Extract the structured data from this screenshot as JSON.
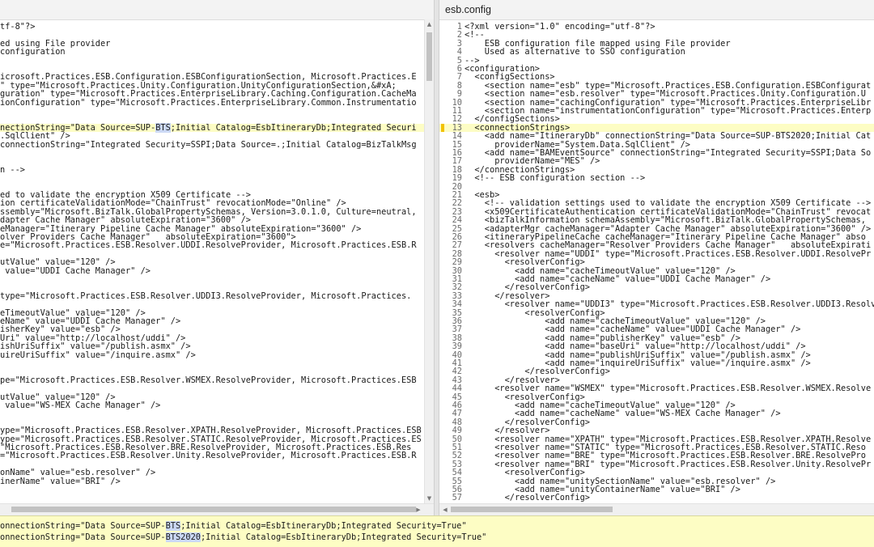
{
  "right": {
    "title": "esb.config"
  },
  "left_lines": [
    "tf-8\"?>",
    "",
    "ed using File provider",
    "configuration",
    "",
    "",
    "icrosoft.Practices.ESB.Configuration.ESBConfigurationSection, Microsoft.Practices.E",
    "\" type=\"Microsoft.Practices.Unity.Configuration.UnityConfigurationSection,&#xA;",
    "guration\" type=\"Microsoft.Practices.EnterpriseLibrary.Caching.Configuration.CacheMa",
    "ionConfiguration\" type=\"Microsoft.Practices.EnterpriseLibrary.Common.Instrumentatio",
    "",
    "",
    "nectionString=\"Data Source=SUP-BTS;Initial Catalog=EsbItineraryDb;Integrated Securi",
    ".SqlClient\" />",
    "connectionString=\"Integrated Security=SSPI;Data Source=.;Initial Catalog=BizTalkMsg",
    "",
    "",
    "n -->",
    "",
    "",
    "ed to validate the encryption X509 Certificate -->",
    "ion certificateValidationMode=\"ChainTrust\" revocationMode=\"Online\" />",
    "ssembly=\"Microsoft.BizTalk.GlobalPropertySchemas, Version=3.0.1.0, Culture=neutral,",
    "dapter Cache Manager\" absoluteExpiration=\"3600\" />",
    "eManager=\"Itinerary Pipeline Cache Manager\" absoluteExpiration=\"3600\" />",
    "olver Providers Cache Manager\"   absoluteExpiration=\"3600\">",
    "e=\"Microsoft.Practices.ESB.Resolver.UDDI.ResolveProvider, Microsoft.Practices.ESB.R",
    "",
    "utValue\" value=\"120\" />",
    " value=\"UDDI Cache Manager\" />",
    "",
    "",
    "type=\"Microsoft.Practices.ESB.Resolver.UDDI3.ResolveProvider, Microsoft.Practices.",
    "",
    "eTimeoutValue\" value=\"120\" />",
    "eName\" value=\"UDDI Cache Manager\" />",
    "isherKey\" value=\"esb\" />",
    "Uri\" value=\"http://localhost/uddi\" />",
    "ishUriSuffix\" value=\"/publish.asmx\" />",
    "uireUriSuffix\" value=\"/inquire.asmx\" />",
    "",
    "",
    "pe=\"Microsoft.Practices.ESB.Resolver.WSMEX.ResolveProvider, Microsoft.Practices.ESB",
    "",
    "utValue\" value=\"120\" />",
    " value=\"WS-MEX Cache Manager\" />",
    "",
    "",
    "ype=\"Microsoft.Practices.ESB.Resolver.XPATH.ResolveProvider, Microsoft.Practices.ESB",
    "ype=\"Microsoft.Practices.ESB.Resolver.STATIC.ResolveProvider, Microsoft.Practices.ES",
    "\"Microsoft.Practices.ESB.Resolver.BRE.ResolveProvider, Microsoft.Practices.ESB.Res",
    "=\"Microsoft.Practices.ESB.Resolver.Unity.ResolveProvider, Microsoft.Practices.ESB.R",
    "",
    "onName\" value=\"esb.resolver\" />",
    "inerName\" value=\"BRI\" />"
  ],
  "right_lines": [
    "<?xml version=\"1.0\" encoding=\"utf-8\"?>",
    "<!--",
    "    ESB configuration file mapped using File provider",
    "    Used as alternative to SSO configuration",
    "-->",
    "<configuration>",
    "  <configSections>",
    "    <section name=\"esb\" type=\"Microsoft.Practices.ESB.Configuration.ESBConfigurat",
    "    <section name=\"esb.resolver\" type=\"Microsoft.Practices.Unity.Configuration.U",
    "    <section name=\"cachingConfiguration\" type=\"Microsoft.Practices.EnterpriseLibr",
    "    <section name=\"instrumentationConfiguration\" type=\"Microsoft.Practices.Enterp",
    "  </configSections>",
    "  <connectionStrings>",
    "    <add name=\"ItineraryDb\" connectionString=\"Data Source=SUP-BTS2020;Initial Cat",
    "      providerName=\"System.Data.SqlClient\" />",
    "    <add name=\"BAMEventSource\" connectionString=\"Integrated Security=SSPI;Data So",
    "      providerName=\"MES\" />",
    "  </connectionStrings>",
    "  <!-- ESB configuration section -->",
    "",
    "  <esb>",
    "    <!-- validation settings used to validate the encryption X509 Certificate -->",
    "    <x509CertificateAuthentication certificateValidationMode=\"ChainTrust\" revocat",
    "    <bizTalkInformation schemaAssembly=\"Microsoft.BizTalk.GlobalPropertySchemas, ",
    "    <adapterMgr cacheManager=\"Adapter Cache Manager\" absoluteExpiration=\"3600\" />",
    "    <itineraryPipelineCache cacheManager=\"Itinerary Pipeline Cache Manager\" abso",
    "    <resolvers cacheManager=\"Resolver Providers Cache Manager\"   absoluteExpirati",
    "      <resolver name=\"UDDI\" type=\"Microsoft.Practices.ESB.Resolver.UDDI.ResolvePr",
    "        <resolverConfig>",
    "          <add name=\"cacheTimeoutValue\" value=\"120\" />",
    "          <add name=\"cacheName\" value=\"UDDI Cache Manager\" />",
    "        </resolverConfig>",
    "      </resolver>",
    "        <resolver name=\"UDDI3\" type=\"Microsoft.Practices.ESB.Resolver.UDDI3.Resolv",
    "            <resolverConfig>",
    "                <add name=\"cacheTimeoutValue\" value=\"120\" />",
    "                <add name=\"cacheName\" value=\"UDDI Cache Manager\" />",
    "                <add name=\"publisherKey\" value=\"esb\" />",
    "                <add name=\"baseUri\" value=\"http://localhost/uddi\" />",
    "                <add name=\"publishUriSuffix\" value=\"/publish.asmx\" />",
    "                <add name=\"inquireUriSuffix\" value=\"/inquire.asmx\" />",
    "            </resolverConfig>",
    "        </resolver>",
    "      <resolver name=\"WSMEX\" type=\"Microsoft.Practices.ESB.Resolver.WSMEX.Resolve",
    "        <resolverConfig>",
    "          <add name=\"cacheTimeoutValue\" value=\"120\" />",
    "          <add name=\"cacheName\" value=\"WS-MEX Cache Manager\" />",
    "        </resolverConfig>",
    "      </resolver>",
    "      <resolver name=\"XPATH\" type=\"Microsoft.Practices.ESB.Resolver.XPATH.Resolve",
    "      <resolver name=\"STATIC\" type=\"Microsoft.Practices.ESB.Resolver.STATIC.Reso",
    "      <resolver name=\"BRE\" type=\"Microsoft.Practices.ESB.Resolver.BRE.ResolvePro",
    "      <resolver name=\"BRI\" type=\"Microsoft.Practices.ESB.Resolver.Unity.ResolvePr",
    "        <resolverConfig>",
    "          <add name=\"unitySectionName\" value=\"esb.resolver\" />",
    "          <add name=\"unityContainerName\" value=\"BRI\" />",
    "        </resolverConfig>"
  ],
  "highlight_index": 12,
  "diff": {
    "line_old": "onnectionString=\"Data Source=SUP-BTS;Initial Catalog=EsbItineraryDb;Integrated Security=True\"",
    "line_new": "onnectionString=\"Data Source=SUP-BTS2020;Initial Catalog=EsbItineraryDb;Integrated Security=True\""
  },
  "colors": {
    "highlight_bg": "#fdfdc4",
    "diff_token_bg": "#cbd8f5",
    "change_marker": "#f2c200"
  }
}
